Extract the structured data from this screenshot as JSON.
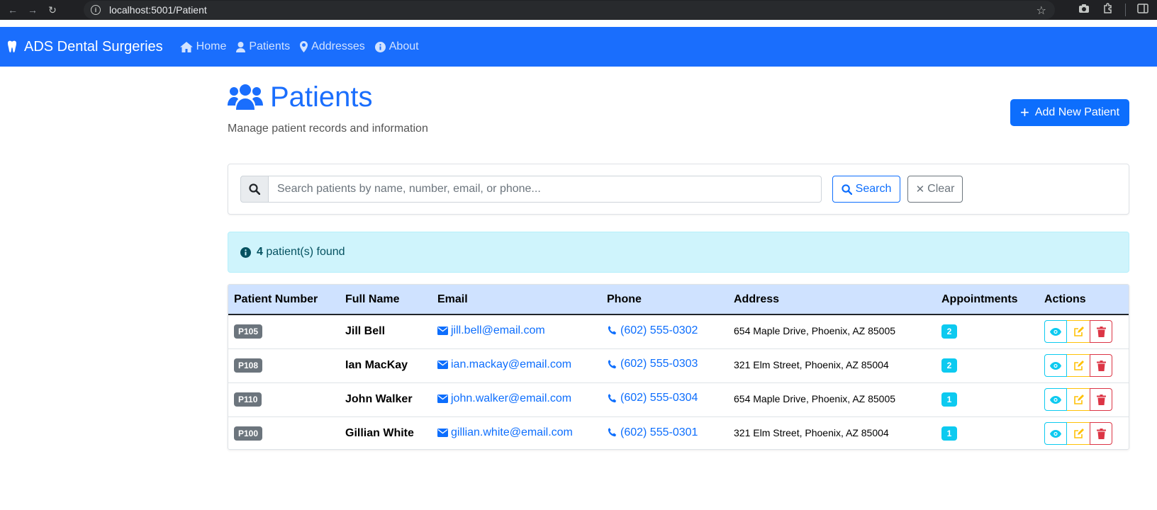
{
  "browser": {
    "url": "localhost:5001/Patient"
  },
  "navbar": {
    "brand": "ADS Dental Surgeries",
    "links": [
      {
        "label": "Home",
        "icon": "home-icon"
      },
      {
        "label": "Patients",
        "icon": "user-icon"
      },
      {
        "label": "Addresses",
        "icon": "map-marker-icon"
      },
      {
        "label": "About",
        "icon": "info-circle-icon"
      }
    ]
  },
  "header": {
    "title": "Patients",
    "subtitle": "Manage patient records and information",
    "add_button": "Add New Patient"
  },
  "search": {
    "placeholder": "Search patients by name, number, email, or phone...",
    "value": "",
    "search_label": "Search",
    "clear_label": "Clear"
  },
  "alert": {
    "count": "4",
    "text": "patient(s) found"
  },
  "table": {
    "columns": [
      "Patient Number",
      "Full Name",
      "Email",
      "Phone",
      "Address",
      "Appointments",
      "Actions"
    ],
    "rows": [
      {
        "number": "P105",
        "name": "Jill Bell",
        "email": "jill.bell@email.com",
        "phone": "(602) 555-0302",
        "address": "654 Maple Drive, Phoenix, AZ 85005",
        "appointments": "2"
      },
      {
        "number": "P108",
        "name": "Ian MacKay",
        "email": "ian.mackay@email.com",
        "phone": "(602) 555-0303",
        "address": "321 Elm Street, Phoenix, AZ 85004",
        "appointments": "2"
      },
      {
        "number": "P110",
        "name": "John Walker",
        "email": "john.walker@email.com",
        "phone": "(602) 555-0304",
        "address": "654 Maple Drive, Phoenix, AZ 85005",
        "appointments": "1"
      },
      {
        "number": "P100",
        "name": "Gillian White",
        "email": "gillian.white@email.com",
        "phone": "(602) 555-0301",
        "address": "321 Elm Street, Phoenix, AZ 85004",
        "appointments": "1"
      }
    ]
  },
  "colors": {
    "primary": "#0d6efd",
    "navbar": "#1a6efd",
    "info": "#0dcaf0",
    "warning": "#ffc107",
    "danger": "#dc3545",
    "secondary": "#6c757d",
    "alert_bg": "#cff4fc",
    "table_header_bg": "#cfe2ff"
  }
}
